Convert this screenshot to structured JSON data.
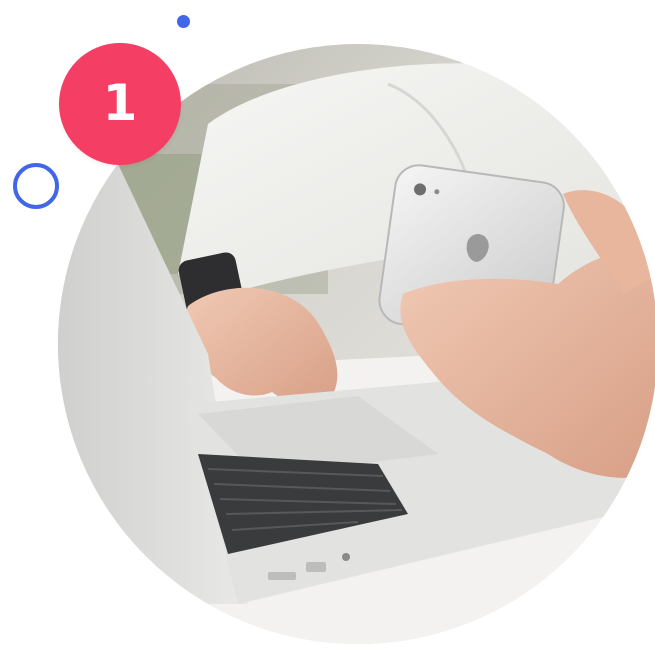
{
  "badge": {
    "number": "1",
    "color": "#f43e63"
  },
  "accents": {
    "color": "#4266e8"
  },
  "photo": {
    "subject_icon": "person-using-laptop-and-smartphone"
  }
}
